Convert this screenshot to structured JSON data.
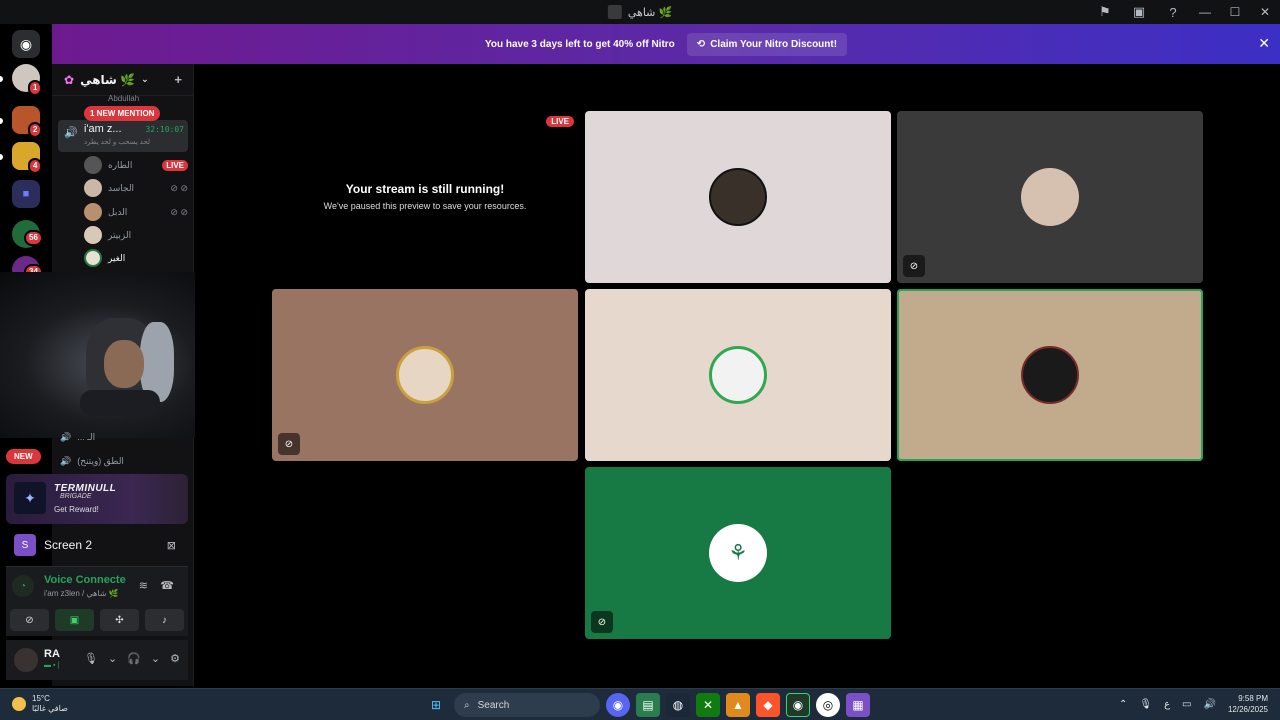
{
  "window": {
    "title": "شاهي 🌿"
  },
  "banner": {
    "message": "You have 3 days left to get 40% off Nitro",
    "cta": "Claim Your Nitro Discount!"
  },
  "servers": [
    {
      "badge": "1"
    },
    {
      "badge": "2"
    },
    {
      "badge": "4"
    },
    {
      "badge": ""
    },
    {
      "badge": "56"
    },
    {
      "badge": "34"
    }
  ],
  "sidebar": {
    "guild_name": "شاهي 🌿",
    "top_truncated": "Abdullah",
    "mention_pill": "1 NEW MENTION",
    "active_channel": {
      "name": "i'am z...",
      "timer": "32:10:07",
      "status": "لحد يسحب و لحد يطرد"
    },
    "members": [
      {
        "name": "الطاره",
        "tag": "LIVE"
      },
      {
        "name": "الجاسد",
        "tag": ""
      },
      {
        "name": "الدبل",
        "tag": ""
      },
      {
        "name": "الزبيتر",
        "tag": ""
      },
      {
        "name": "الغير",
        "tag": ""
      }
    ],
    "channel_bottom_1": "... الـ ",
    "channel_bottom_2": "الطق (ويتنح)",
    "new_pill": "NEW"
  },
  "reward": {
    "brand": "TERMINULL",
    "brand_sub": "BRIGADE",
    "cta": "Get Reward!"
  },
  "screen_share": {
    "label": "Screen 2",
    "icon_letter": "S"
  },
  "voice": {
    "status": "Voice Connecte",
    "location": "i'am z3len / شاهي 🌿"
  },
  "user": {
    "name": "RA",
    "status": "▬ ▪ |"
  },
  "stage": {
    "paused_tile": {
      "live": "LIVE",
      "heading": "Your stream is still running!",
      "subtext": "We've paused this preview to save your resources."
    },
    "tiles": [
      {
        "bg": "#e0d8d8"
      },
      {
        "bg": "#3a3a3a"
      },
      {
        "bg": "#9a7462"
      },
      {
        "bg": "#e6d8cc"
      },
      {
        "bg": "#c2aa8c"
      },
      {
        "bg": "#177a44"
      }
    ]
  },
  "taskbar": {
    "temp": "15°C",
    "weather": "صافي غالبًا",
    "search": "Search",
    "lang": "ع",
    "time": "9:58 PM",
    "date": "12/26/2025"
  }
}
